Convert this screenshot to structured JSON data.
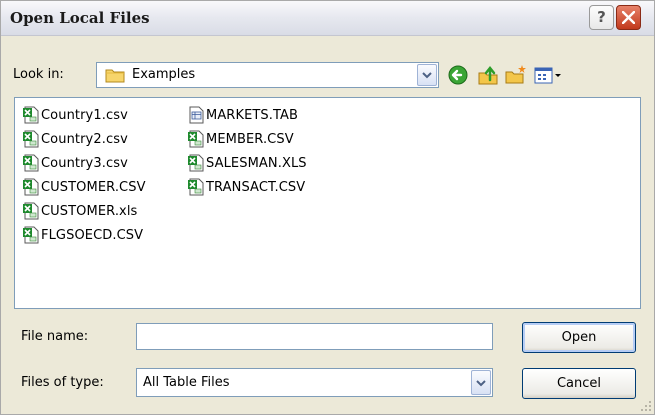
{
  "window": {
    "title": "Open Local Files"
  },
  "title_buttons": {
    "help": "?"
  },
  "lookin": {
    "label": "Look in:",
    "value": "Examples"
  },
  "files": [
    {
      "name": "Country1.csv",
      "icon": "excel-file-icon"
    },
    {
      "name": "Country2.csv",
      "icon": "excel-file-icon"
    },
    {
      "name": "Country3.csv",
      "icon": "excel-file-icon"
    },
    {
      "name": "CUSTOMER.CSV",
      "icon": "excel-file-icon"
    },
    {
      "name": "CUSTOMER.xls",
      "icon": "excel-file-icon"
    },
    {
      "name": "FLGSOECD.CSV",
      "icon": "excel-file-icon"
    },
    {
      "name": "MARKETS.TAB",
      "icon": "generic-file-icon"
    },
    {
      "name": "MEMBER.CSV",
      "icon": "excel-file-icon"
    },
    {
      "name": "SALESMAN.XLS",
      "icon": "excel-file-icon"
    },
    {
      "name": "TRANSACT.CSV",
      "icon": "excel-file-icon"
    }
  ],
  "filename": {
    "label": "File name:",
    "value": ""
  },
  "filetype": {
    "label": "Files of type:",
    "value": "All Table Files"
  },
  "buttons": {
    "open": "Open",
    "cancel": "Cancel"
  }
}
